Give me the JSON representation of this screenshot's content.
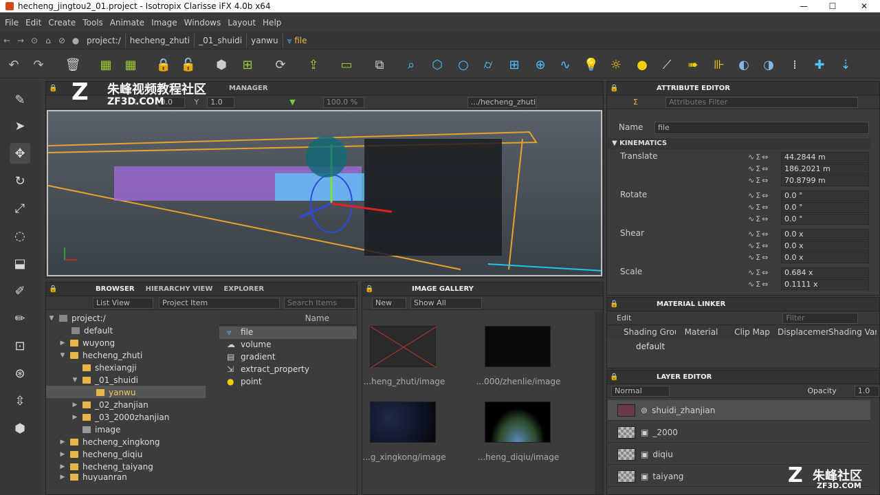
{
  "window": {
    "title": "hecheng_jingtou2_01.project - Isotropix Clarisse iFX 4.0b x64",
    "minimize": "—",
    "maximize": "☐",
    "close": "✕"
  },
  "menu": [
    "File",
    "Edit",
    "Create",
    "Tools",
    "Animate",
    "Image",
    "Windows",
    "Layout",
    "Help"
  ],
  "path": {
    "crumbs": [
      "project:/",
      "hecheng_zhuti",
      "_01_shuidi",
      "yanwu"
    ],
    "current": "file"
  },
  "viewport": {
    "header_tabs": [
      "MANAGER"
    ],
    "field_x": "0.0",
    "field_y": "1.0",
    "zoom": "100.0 %",
    "context": ".../hecheng_zhuti"
  },
  "browser": {
    "tabs": [
      "BROWSER",
      "HIERARCHY VIEW",
      "EXPLORER"
    ],
    "view_mode": "List View",
    "item_type": "Project Item",
    "search_placeholder": "Search Items",
    "column_name": "Name",
    "tree": [
      "project:/",
      "default",
      "wuyong",
      "hecheng_zhuti",
      "shexiangji",
      "_01_shuidi",
      "yanwu",
      "_02_zhanjian",
      "_03_2000zhanjian",
      "image",
      "hecheng_xingkong",
      "hecheng_diqiu",
      "hecheng_taiyang",
      "huyuanran"
    ],
    "items": [
      "file",
      "volume",
      "gradient",
      "extract_property",
      "point"
    ]
  },
  "gallery": {
    "title": "IMAGE GALLERY",
    "new_label": "New",
    "filter": "Show All",
    "captions": [
      "...heng_zhuti/image",
      "...000/zhenlie/image",
      "...g_xingkong/image",
      "...heng_diqiu/image"
    ]
  },
  "attribute_editor": {
    "title": "ATTRIBUTE EDITOR",
    "filter_placeholder": "Attributes Filter",
    "name_label": "Name",
    "name_value": "file",
    "section": "KINEMATICS",
    "translate_label": "Translate",
    "translate": [
      "44.2844 m",
      "186.2021 m",
      "70.8799 m"
    ],
    "rotate_label": "Rotate",
    "rotate": [
      "0.0 °",
      "0.0 °",
      "0.0 °"
    ],
    "shear_label": "Shear",
    "shear": [
      "0.0 x",
      "0.0 x",
      "0.0 x"
    ],
    "scale_label": "Scale",
    "scale": [
      "0.684 x",
      "0.1111 x"
    ]
  },
  "material_linker": {
    "title": "MATERIAL LINKER",
    "edit_label": "Edit",
    "filter_placeholder": "Filter",
    "columns": [
      "Shading Group",
      "Material",
      "Clip Map",
      "Displacement",
      "Shading Variable"
    ],
    "row_name": "default"
  },
  "layer_editor": {
    "title": "LAYER EDITOR",
    "blend_mode": "Normal",
    "opacity_label": "Opacity",
    "opacity_value": "1.0",
    "layers": [
      "shuidi_zhanjian",
      "_2000",
      "diqiu",
      "taiyang"
    ]
  },
  "watermarks": {
    "top_text": "朱峰视频教程社区",
    "top_url": "ZF3D.COM",
    "bottom_text": "朱峰社区",
    "bottom_url": "ZF3D.COM"
  },
  "colors": {
    "accent": "#f0b84a",
    "selection": "#5a5a5a",
    "bbox": "#e8a32a"
  }
}
